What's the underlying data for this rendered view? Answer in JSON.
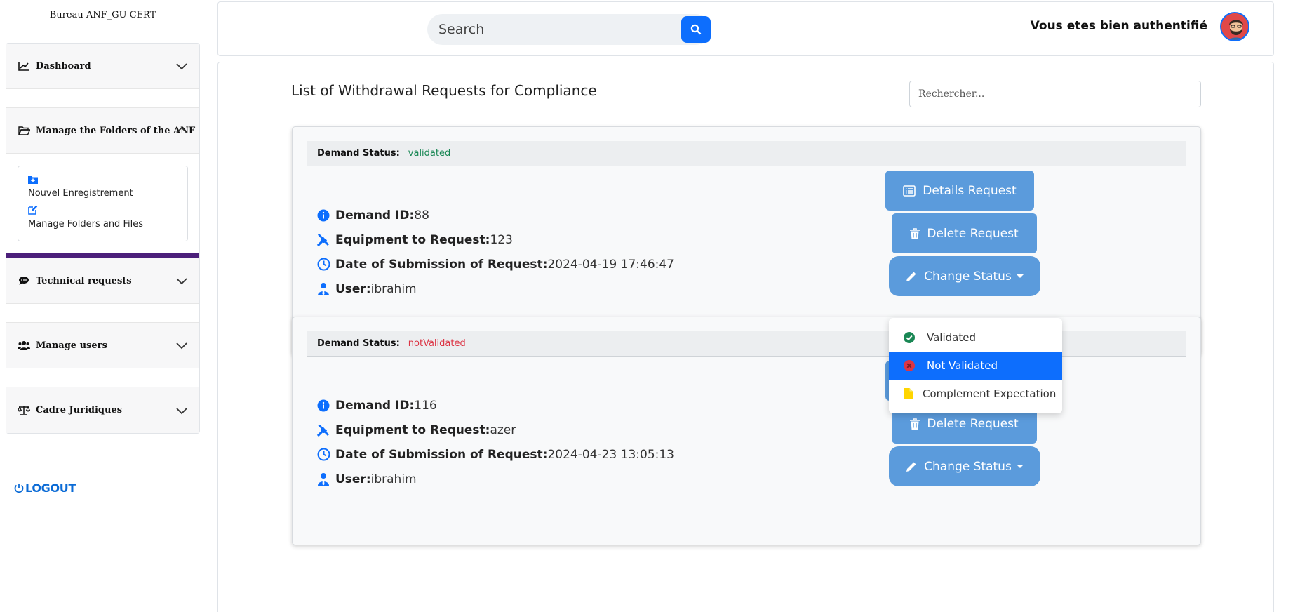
{
  "sidebar": {
    "brand": "Bureau ANF_GU CERT",
    "sections": [
      {
        "label": "Dashboard",
        "icon": "chart-line-icon"
      },
      {
        "label": "Manage the Folders of the ANF",
        "icon": "folder-open-icon"
      },
      {
        "label": "Technical requests",
        "icon": "comments-icon"
      },
      {
        "label": "Manage users",
        "icon": "users-icon"
      },
      {
        "label": "Cadre Juridiques",
        "icon": "scale-icon"
      }
    ],
    "submenu": [
      {
        "label": "Nouvel Enregistrement",
        "icon": "folder-plus-icon"
      },
      {
        "label": "Manage Folders and Files",
        "icon": "edit-icon"
      }
    ],
    "logout_label": "LOGOUT"
  },
  "header": {
    "search_placeholder": "Search",
    "auth_text": "Vous etes bien authentifié"
  },
  "main": {
    "title": "List of Withdrawal Requests for Compliance",
    "filter_placeholder": "Rechercher...",
    "labels": {
      "status": "Demand Status:",
      "id": "Demand ID:",
      "equipment": "Equipment to Request:",
      "date": "Date of Submission of Request:",
      "user": "User:"
    },
    "buttons": {
      "details": "Details Request",
      "delete": "Delete Request",
      "change": "Change Status"
    },
    "requests": [
      {
        "status": "validated",
        "id": "88",
        "equipment": "123",
        "date": "2024-04-19 17:46:47",
        "user": "ibrahim"
      },
      {
        "status": "notValidated",
        "id": "116",
        "equipment": "azer",
        "date": "2024-04-23 13:05:13",
        "user": "ibrahim"
      }
    ]
  },
  "dropdown": {
    "items": [
      {
        "label": "Validated",
        "icon": "check-circle-icon"
      },
      {
        "label": "Not Validated",
        "icon": "x-circle-icon"
      },
      {
        "label": "Complement Expectation",
        "icon": "file-icon"
      }
    ]
  },
  "colors": {
    "primary": "#0d6efd",
    "button": "#5b9bdc",
    "validated": "#198754",
    "not_validated": "#dc3545",
    "purple_bar": "#4b1f7a"
  }
}
